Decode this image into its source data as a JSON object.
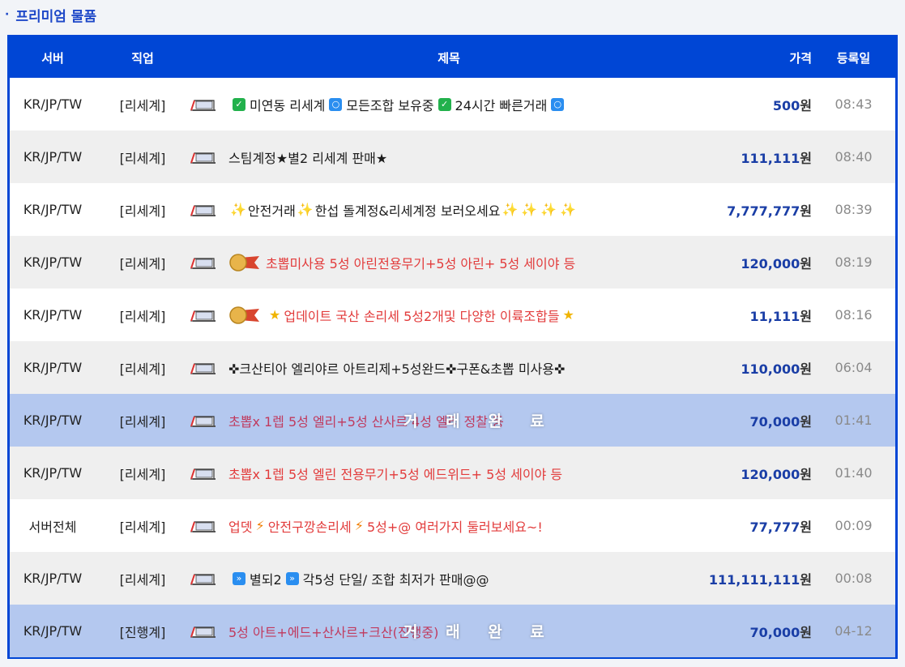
{
  "section": {
    "bullet": "·",
    "title": "프리미엄 물품"
  },
  "columns": {
    "server": "서버",
    "job": "직업",
    "title": "제목",
    "price": "가격",
    "date": "등록일"
  },
  "status": {
    "done_label": "거 래 완 료"
  },
  "price_unit": "원",
  "rows": [
    {
      "server": "KR/JP/TW",
      "job": "[리세계]",
      "title": "미연동 리세계",
      "title_b": "모든조합 보유중",
      "title_c": "24시간 빠른거래",
      "price": "500",
      "date": "08:43"
    },
    {
      "server": "KR/JP/TW",
      "job": "[리세계]",
      "title": "스팀계정★별2 리세계 판매★",
      "price": "111,111",
      "date": "08:40"
    },
    {
      "server": "KR/JP/TW",
      "job": "[리세계]",
      "title": "안전거래",
      "title_b": "한섭 돌계정&리세계정 보러오세요",
      "price": "7,777,777",
      "date": "08:39"
    },
    {
      "server": "KR/JP/TW",
      "job": "[리세계]",
      "title": "초뽑미사용 5성 아린전용무기+5성 아린+ 5성 세이야 등",
      "price": "120,000",
      "date": "08:19"
    },
    {
      "server": "KR/JP/TW",
      "job": "[리세계]",
      "title": "업데이트 국산 손리세 5성2개및 다양한 이륙조합들",
      "price": "11,111",
      "date": "08:16"
    },
    {
      "server": "KR/JP/TW",
      "job": "[리세계]",
      "title": "✜크산티아 엘리야르 아트리제+5성완드✜구폰&초뽑 미사용✜",
      "price": "110,000",
      "date": "06:04"
    },
    {
      "server": "KR/JP/TW",
      "job": "[리세계]",
      "title": "초뽑x 1렙 5성 엘리+5성 산사르 4성 엘리 정찰 등",
      "price": "70,000",
      "date": "01:41"
    },
    {
      "server": "KR/JP/TW",
      "job": "[리세계]",
      "title": "초뽑x 1렙 5성 엘린 전용무기+5성 에드위드+ 5성 세이야 등",
      "price": "120,000",
      "date": "01:40"
    },
    {
      "server": "서버전체",
      "job": "[리세계]",
      "title": "업뎃",
      "title_b": "안전구깡손리세",
      "title_c": "5성+@ 여러가지 둘러보세요~!",
      "price": "77,777",
      "date": "00:09"
    },
    {
      "server": "KR/JP/TW",
      "job": "[리세계]",
      "title": "별되2",
      "title_b": "각5성 단일/ 조합 최저가 판매@@",
      "price": "111,111,111",
      "date": "00:08"
    },
    {
      "server": "KR/JP/TW",
      "job": "[진행계]",
      "title": "5성 아트+에드+산사르+크산(진행중)",
      "price": "70,000",
      "date": "04-12"
    }
  ]
}
